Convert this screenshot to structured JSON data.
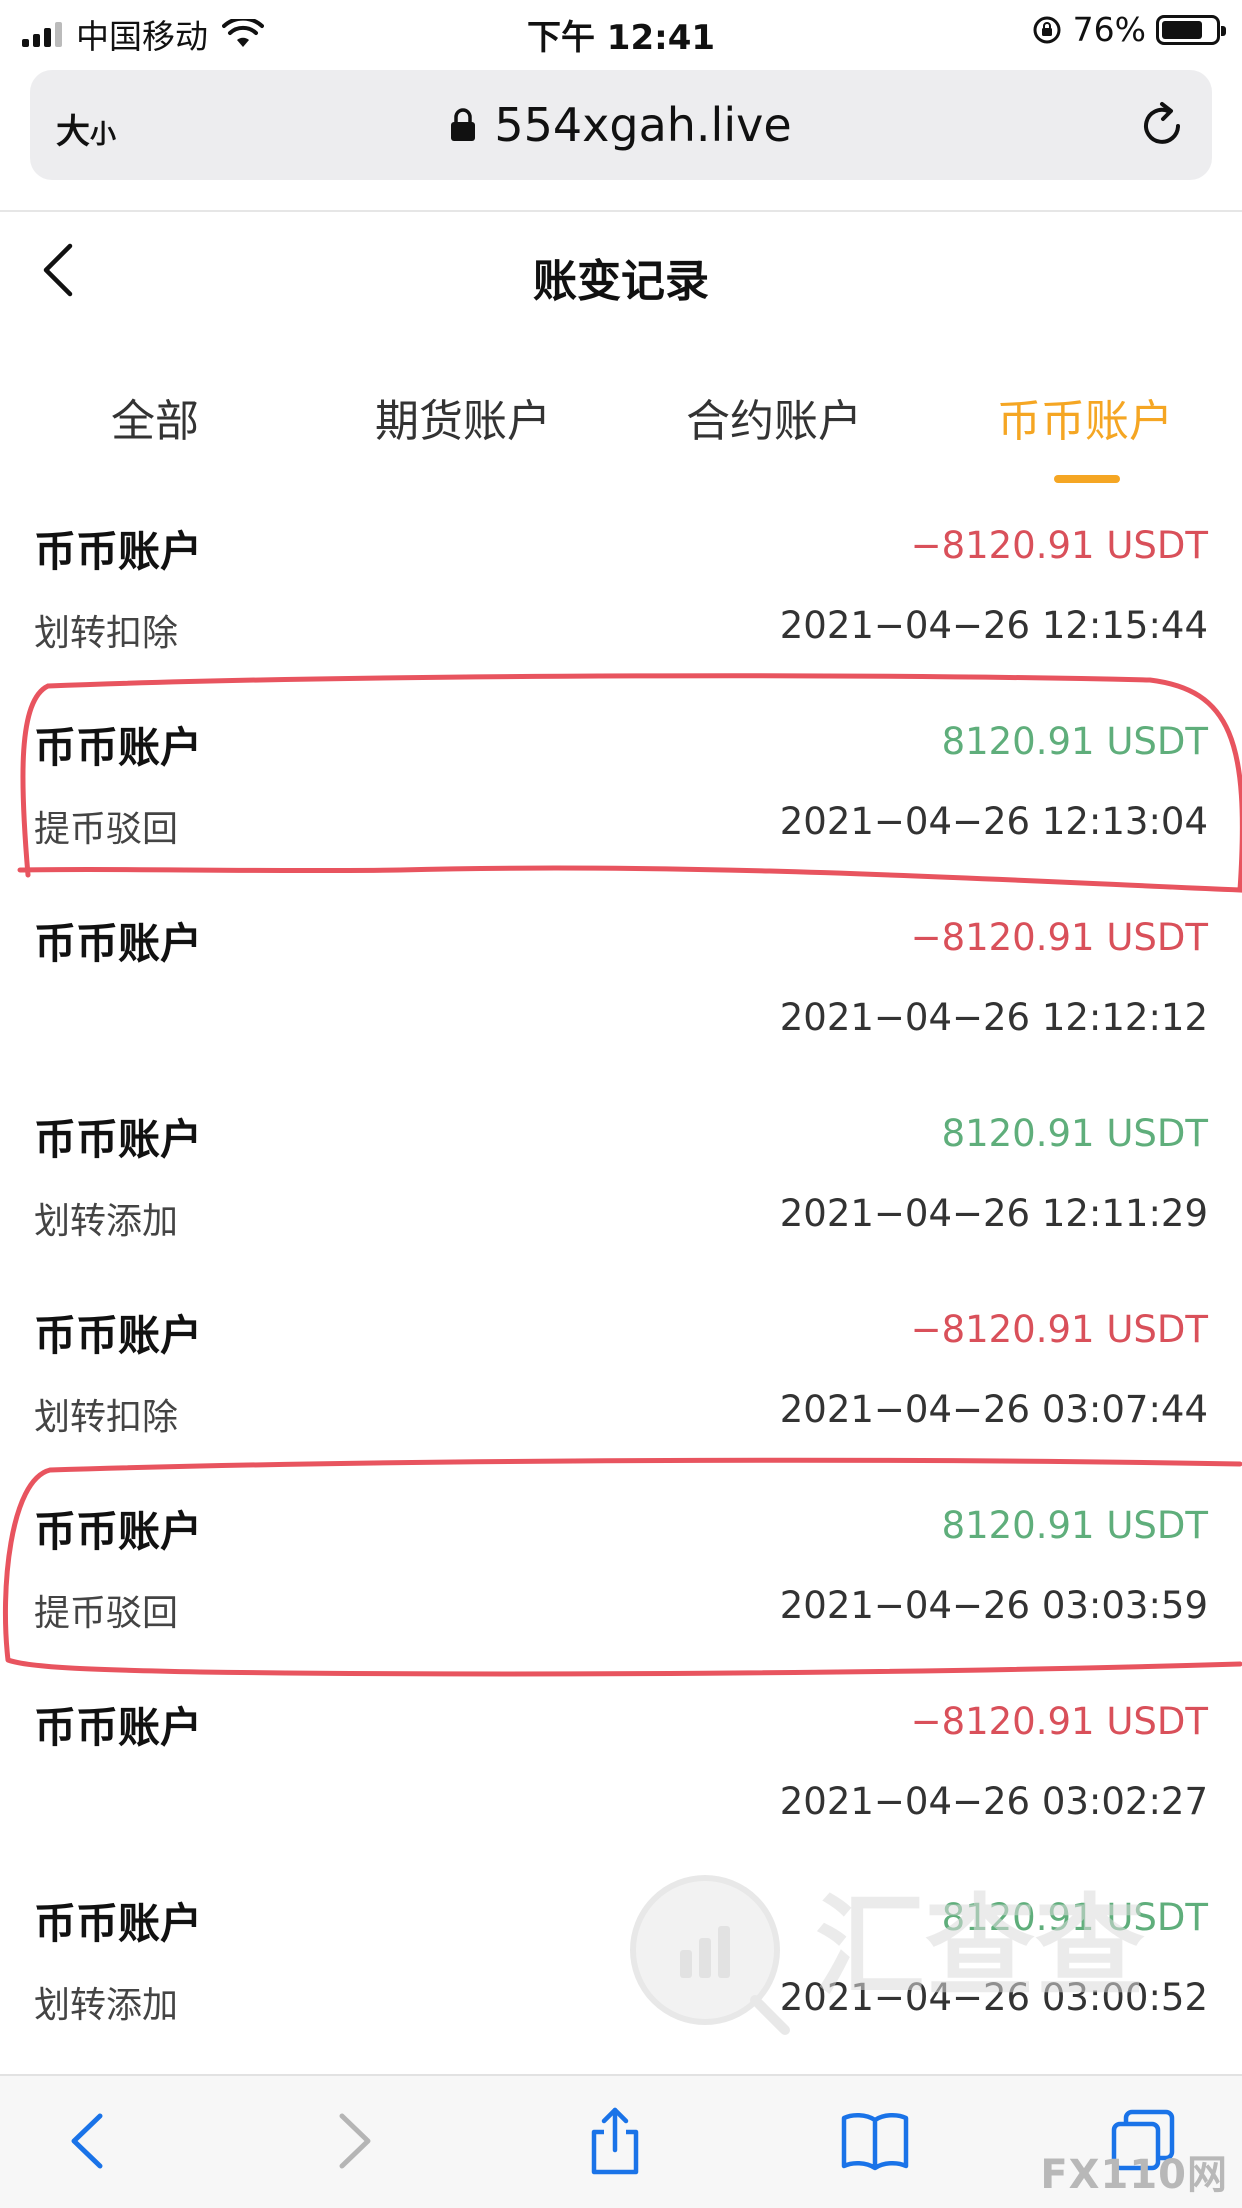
{
  "status_bar": {
    "carrier": "中国移动",
    "time": "下午 12:41",
    "battery_text": "76%",
    "battery_level": 0.76
  },
  "browser": {
    "text_size_main": "大",
    "text_size_small": "小",
    "url": "554xgah.live"
  },
  "page": {
    "title": "账变记录"
  },
  "tabs": [
    {
      "label": "全部",
      "active": false
    },
    {
      "label": "期货账户",
      "active": false
    },
    {
      "label": "合约账户",
      "active": false
    },
    {
      "label": "币币账户",
      "active": true
    }
  ],
  "records": [
    {
      "title": "币币账户",
      "amount": "−8120.91 USDT",
      "type": "negative",
      "desc": "划转扣除",
      "time": "2021−04−26 12:15:44"
    },
    {
      "title": "币币账户",
      "amount": "8120.91 USDT",
      "type": "positive",
      "desc": "提币驳回",
      "time": "2021−04−26 12:13:04"
    },
    {
      "title": "币币账户",
      "amount": "−8120.91 USDT",
      "type": "negative",
      "desc": "",
      "time": "2021−04−26 12:12:12"
    },
    {
      "title": "币币账户",
      "amount": "8120.91 USDT",
      "type": "positive",
      "desc": "划转添加",
      "time": "2021−04−26 12:11:29"
    },
    {
      "title": "币币账户",
      "amount": "−8120.91 USDT",
      "type": "negative",
      "desc": "划转扣除",
      "time": "2021−04−26 03:07:44"
    },
    {
      "title": "币币账户",
      "amount": "8120.91 USDT",
      "type": "positive",
      "desc": "提币驳回",
      "time": "2021−04−26 03:03:59"
    },
    {
      "title": "币币账户",
      "amount": "−8120.91 USDT",
      "type": "negative",
      "desc": "",
      "time": "2021−04−26 03:02:27"
    },
    {
      "title": "币币账户",
      "amount": "8120.91 USDT",
      "type": "positive",
      "desc": "划转添加",
      "time": "2021−04−26 03:00:52"
    }
  ],
  "watermark": {
    "text": "汇查查"
  },
  "badge": {
    "text": "FX110网"
  },
  "colors": {
    "accent": "#f5a623",
    "negative": "#d9505a",
    "positive": "#5fae7b",
    "annotation": "#e8545f",
    "ios_blue": "#1a73e8"
  }
}
